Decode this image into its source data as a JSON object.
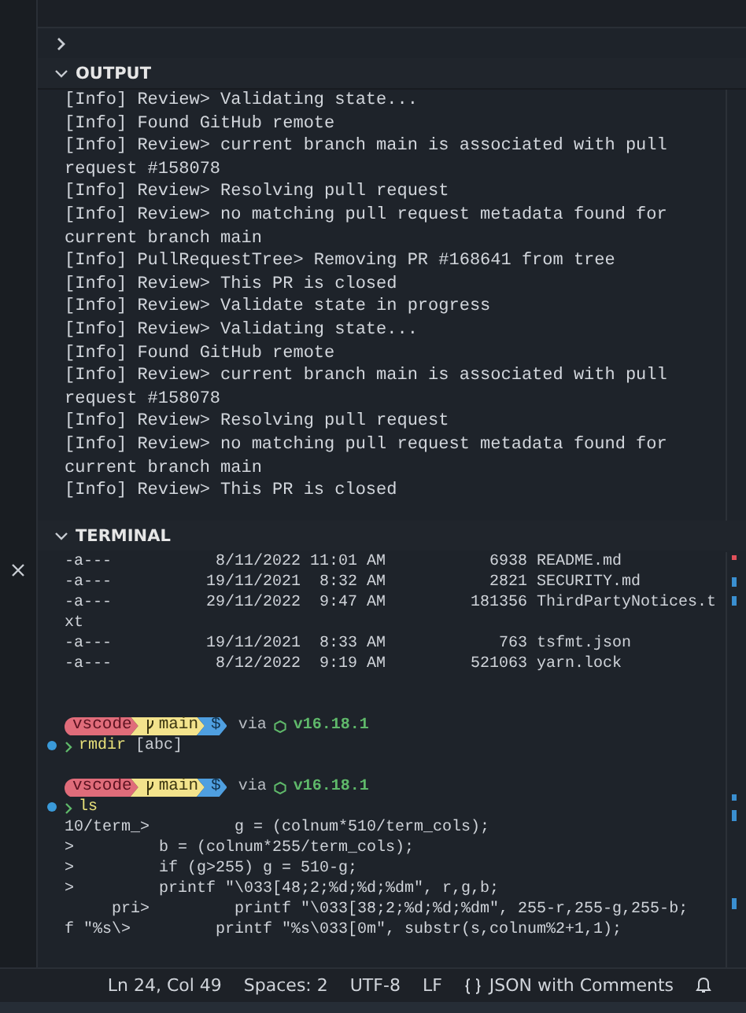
{
  "collapsed_section": {
    "expanded": false
  },
  "output": {
    "title": "OUTPUT",
    "expanded": true,
    "lines": [
      "[Info] Review> Validating state...",
      "[Info] Found GitHub remote",
      "[Info] Review> current branch main is associated with pull",
      "request #158078",
      "[Info] Review> Resolving pull request",
      "[Info] Review> no matching pull request metadata found for",
      "current branch main",
      "[Info] PullRequestTree> Removing PR #168641 from tree",
      "[Info] Review> This PR is closed",
      "[Info] Review> Validate state in progress",
      "[Info] Review> Validating state...",
      "[Info] Found GitHub remote",
      "[Info] Review> current branch main is associated with pull",
      "request #158078",
      "[Info] Review> Resolving pull request",
      "[Info] Review> no matching pull request metadata found for",
      "current branch main",
      "[Info] Review> This PR is closed"
    ]
  },
  "terminal": {
    "title": "TERMINAL",
    "expanded": true,
    "entries": [
      {
        "kind": "listing",
        "mode": "-a---",
        "date": "8/11/2022",
        "time": "11:01 AM",
        "size": "6938",
        "name": "README.md"
      },
      {
        "kind": "listing",
        "mode": "-a---",
        "date": "19/11/2021",
        "time": "8:32 AM",
        "size": "2821",
        "name": "SECURITY.md"
      },
      {
        "kind": "listing",
        "mode": "-a---",
        "date": "29/11/2022",
        "time": "9:47 AM",
        "size": "181356",
        "name": "ThirdPartyNotices.t"
      },
      {
        "kind": "text",
        "text": "xt"
      },
      {
        "kind": "listing",
        "mode": "-a---",
        "date": "19/11/2021",
        "time": "8:33 AM",
        "size": "763",
        "name": "tsfmt.json"
      },
      {
        "kind": "listing",
        "mode": "-a---",
        "date": "8/12/2022",
        "time": "9:19 AM",
        "size": "521063",
        "name": "yarn.lock"
      },
      {
        "kind": "blank"
      },
      {
        "kind": "blank"
      },
      {
        "kind": "prompt",
        "user": "vscode",
        "branch": "main",
        "symbol": "$",
        "via": "via",
        "version": "v16.18.1"
      },
      {
        "kind": "command",
        "name": "rmdir",
        "args": "[abc]"
      },
      {
        "kind": "blank"
      },
      {
        "kind": "prompt",
        "user": "vscode",
        "branch": "main",
        "symbol": "$",
        "via": "via",
        "version": "v16.18.1"
      },
      {
        "kind": "command",
        "name": "ls"
      },
      {
        "kind": "text",
        "text": "10/term_>         g = (colnum*510/term_cols);"
      },
      {
        "kind": "text",
        "text": ">         b = (colnum*255/term_cols);"
      },
      {
        "kind": "text",
        "text": ">         if (g>255) g = 510-g;"
      },
      {
        "kind": "text",
        "text": ">         printf \"\\033[48;2;%d;%d;%dm\", r,g,b;"
      },
      {
        "kind": "text",
        "text": "     pri>         printf \"\\033[38;2;%d;%d;%dm\", 255-r,255-g,255-b;"
      },
      {
        "kind": "text",
        "text": "f \"%s\\>         printf \"%s\\033[0m\", substr(s,colnum%2+1,1);"
      }
    ]
  },
  "status_bar": {
    "position": "Ln 24, Col 49",
    "indent": "Spaces: 2",
    "encoding": "UTF-8",
    "eol": "LF",
    "language": "JSON with Comments"
  }
}
